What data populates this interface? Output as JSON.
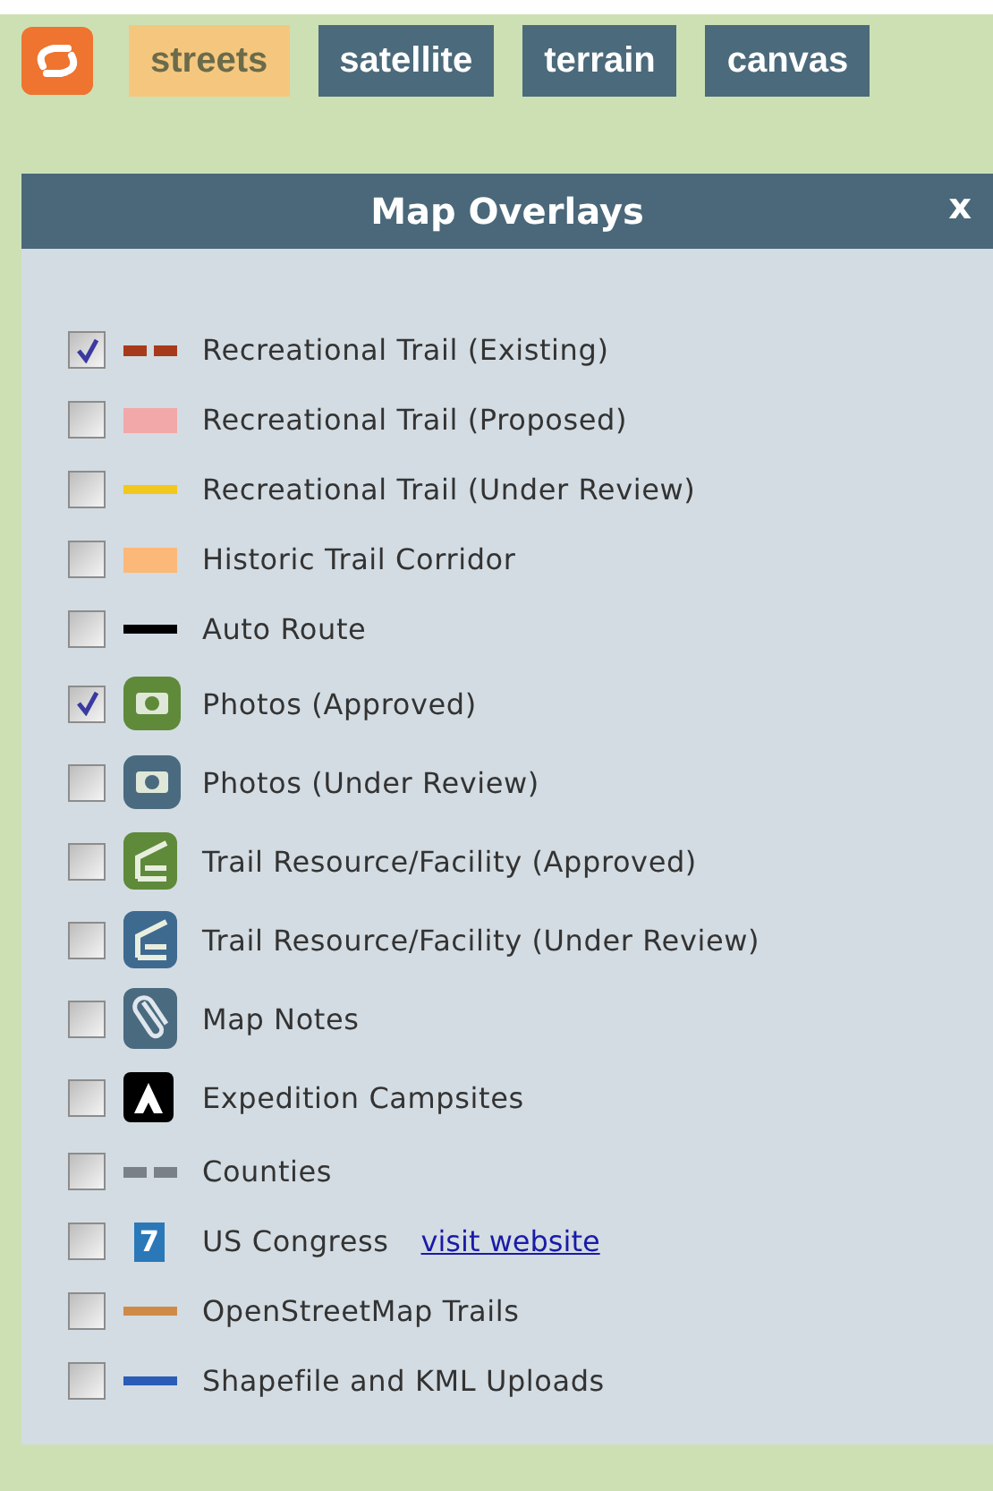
{
  "map_types": [
    {
      "label": "streets",
      "selected": true
    },
    {
      "label": "satellite",
      "selected": false
    },
    {
      "label": "terrain",
      "selected": false
    },
    {
      "label": "canvas",
      "selected": false
    }
  ],
  "panel": {
    "title": "Map Overlays",
    "close": "x"
  },
  "overlays": [
    {
      "label": "Recreational Trail (Existing)",
      "checked": true,
      "kind": "dashed",
      "color": "#a83a1c"
    },
    {
      "label": "Recreational Trail (Proposed)",
      "checked": false,
      "kind": "band",
      "color": "#f2a8a8"
    },
    {
      "label": "Recreational Trail (Under Review)",
      "checked": false,
      "kind": "line",
      "color": "#f2c81c"
    },
    {
      "label": "Historic Trail Corridor",
      "checked": false,
      "kind": "band",
      "color": "#fcb878"
    },
    {
      "label": "Auto Route",
      "checked": false,
      "kind": "line",
      "color": "#000000"
    },
    {
      "label": "Photos (Approved)",
      "checked": true,
      "kind": "photo",
      "color": "#5e8a3a"
    },
    {
      "label": "Photos (Under Review)",
      "checked": false,
      "kind": "photo",
      "color": "#4a6a80"
    },
    {
      "label": "Trail Resource/Facility (Approved)",
      "checked": false,
      "kind": "facility",
      "color": "#5e8a3a"
    },
    {
      "label": "Trail Resource/Facility (Under Review)",
      "checked": false,
      "kind": "facility",
      "color": "#3f6a90"
    },
    {
      "label": "Map Notes",
      "checked": false,
      "kind": "clip",
      "color": "#4a6a80"
    },
    {
      "label": "Expedition Campsites",
      "checked": false,
      "kind": "camp",
      "color": "#000000"
    },
    {
      "label": "Counties",
      "checked": false,
      "kind": "dashed",
      "color": "#7a8088"
    },
    {
      "label": "US Congress",
      "checked": false,
      "kind": "number",
      "color": "#2a78b8",
      "badge": "7",
      "link": "visit website"
    },
    {
      "label": "OpenStreetMap Trails",
      "checked": false,
      "kind": "line",
      "color": "#d08a48"
    },
    {
      "label": "Shapefile and KML Uploads",
      "checked": false,
      "kind": "line",
      "color": "#2a5cb8"
    }
  ]
}
